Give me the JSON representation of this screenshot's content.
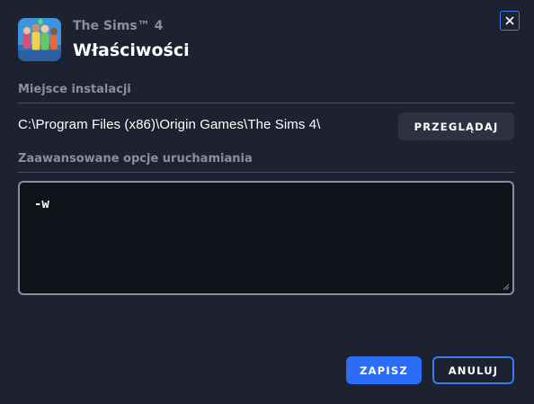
{
  "header": {
    "game_name": "The Sims™ 4",
    "dialog_title": "Właściwości",
    "icon": "the-sims-4-game-icon",
    "close_icon": "close-icon"
  },
  "install_location": {
    "label": "Miejsce instalacji",
    "path": "C:\\Program Files (x86)\\Origin Games\\The Sims 4\\",
    "browse_label": "PRZEGLĄDAJ"
  },
  "launch_options": {
    "label": "Zaawansowane opcje uruchamiania",
    "value": "-w"
  },
  "footer": {
    "save_label": "ZAPISZ",
    "cancel_label": "ANULUJ"
  },
  "colors": {
    "background": "#1e2130",
    "accent": "#2d6cf6",
    "muted_text": "#8a8f9f",
    "secondary_button": "#2e3240"
  }
}
